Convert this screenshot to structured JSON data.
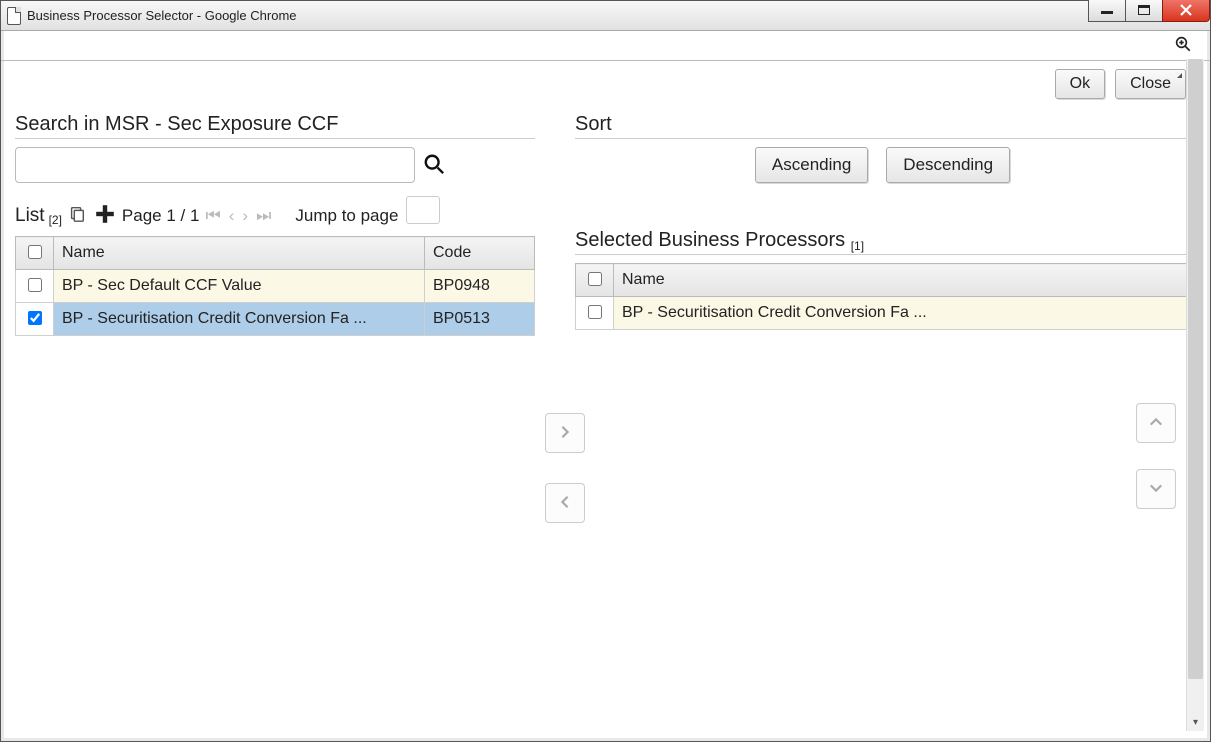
{
  "window": {
    "title": "Business Processor Selector - Google Chrome"
  },
  "actions": {
    "ok": "Ok",
    "close": "Close"
  },
  "search": {
    "label": "Search in MSR - Sec Exposure CCF",
    "value": ""
  },
  "sort": {
    "label": "Sort",
    "asc": "Ascending",
    "desc": "Descending"
  },
  "list": {
    "label": "List",
    "count": "[2]",
    "page_text": "Page 1 / 1",
    "jump_label": "Jump to page",
    "columns": {
      "name": "Name",
      "code": "Code"
    },
    "rows": [
      {
        "checked": false,
        "name": "BP - Sec Default CCF Value",
        "code": "BP0948",
        "alt": true,
        "selected": false
      },
      {
        "checked": true,
        "name": "BP - Securitisation Credit Conversion Fa ...",
        "code": "BP0513",
        "alt": false,
        "selected": true
      }
    ]
  },
  "selected": {
    "label": "Selected Business Processors",
    "count": "[1]",
    "columns": {
      "name": "Name"
    },
    "rows": [
      {
        "checked": false,
        "name": "BP - Securitisation Credit Conversion Fa ..."
      }
    ]
  }
}
